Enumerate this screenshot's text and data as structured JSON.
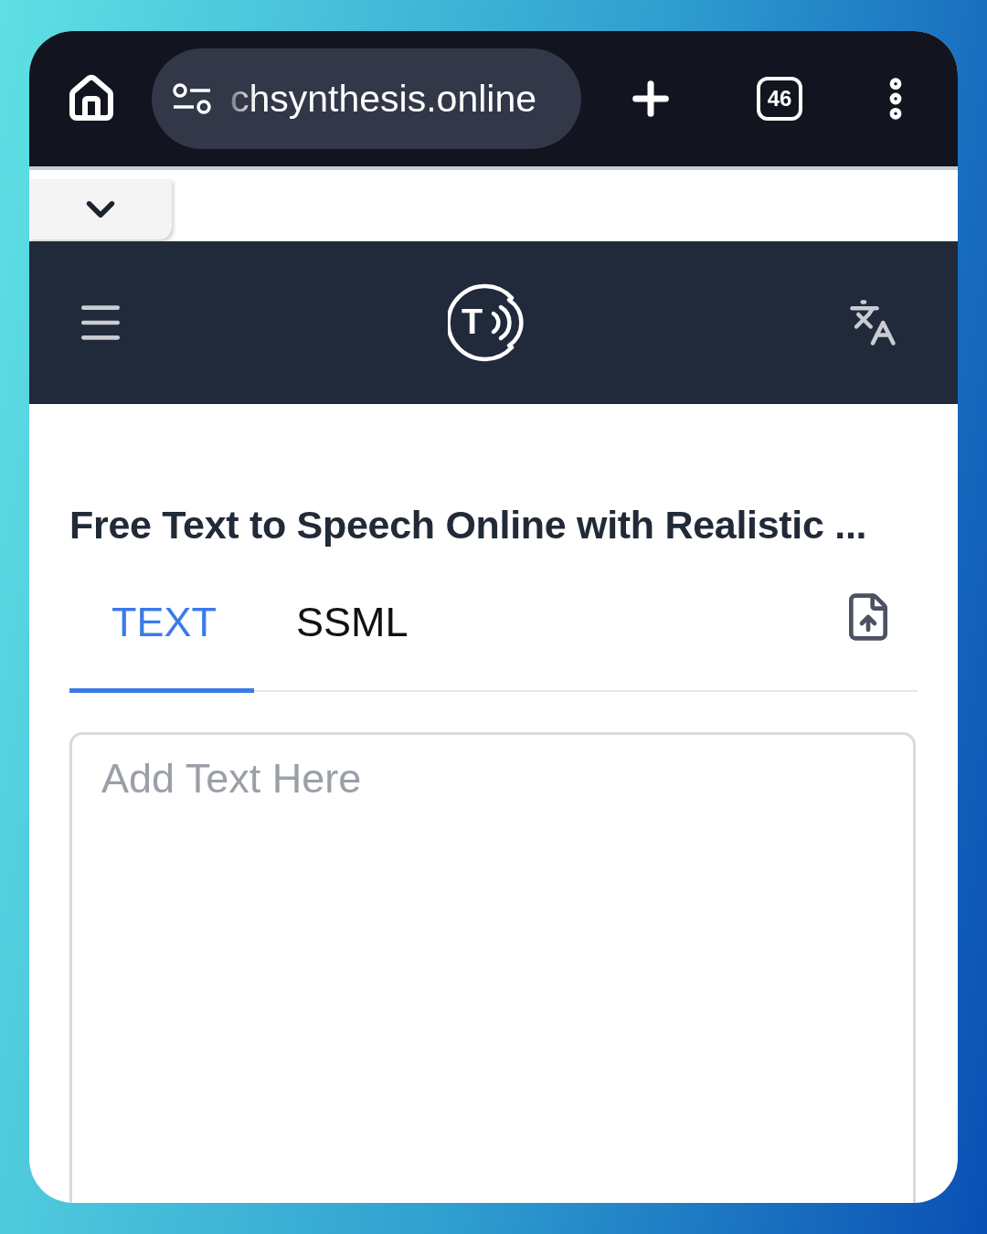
{
  "browser": {
    "url": "chsynthesis.online",
    "tab_count": "46"
  },
  "app": {
    "logo_letter": "T"
  },
  "page": {
    "title": "Free Text to Speech Online with Realistic ...",
    "tabs": [
      {
        "label": "TEXT",
        "selected": true
      },
      {
        "label": "SSML",
        "selected": false
      }
    ],
    "editor": {
      "placeholder": "Add Text Here"
    }
  }
}
